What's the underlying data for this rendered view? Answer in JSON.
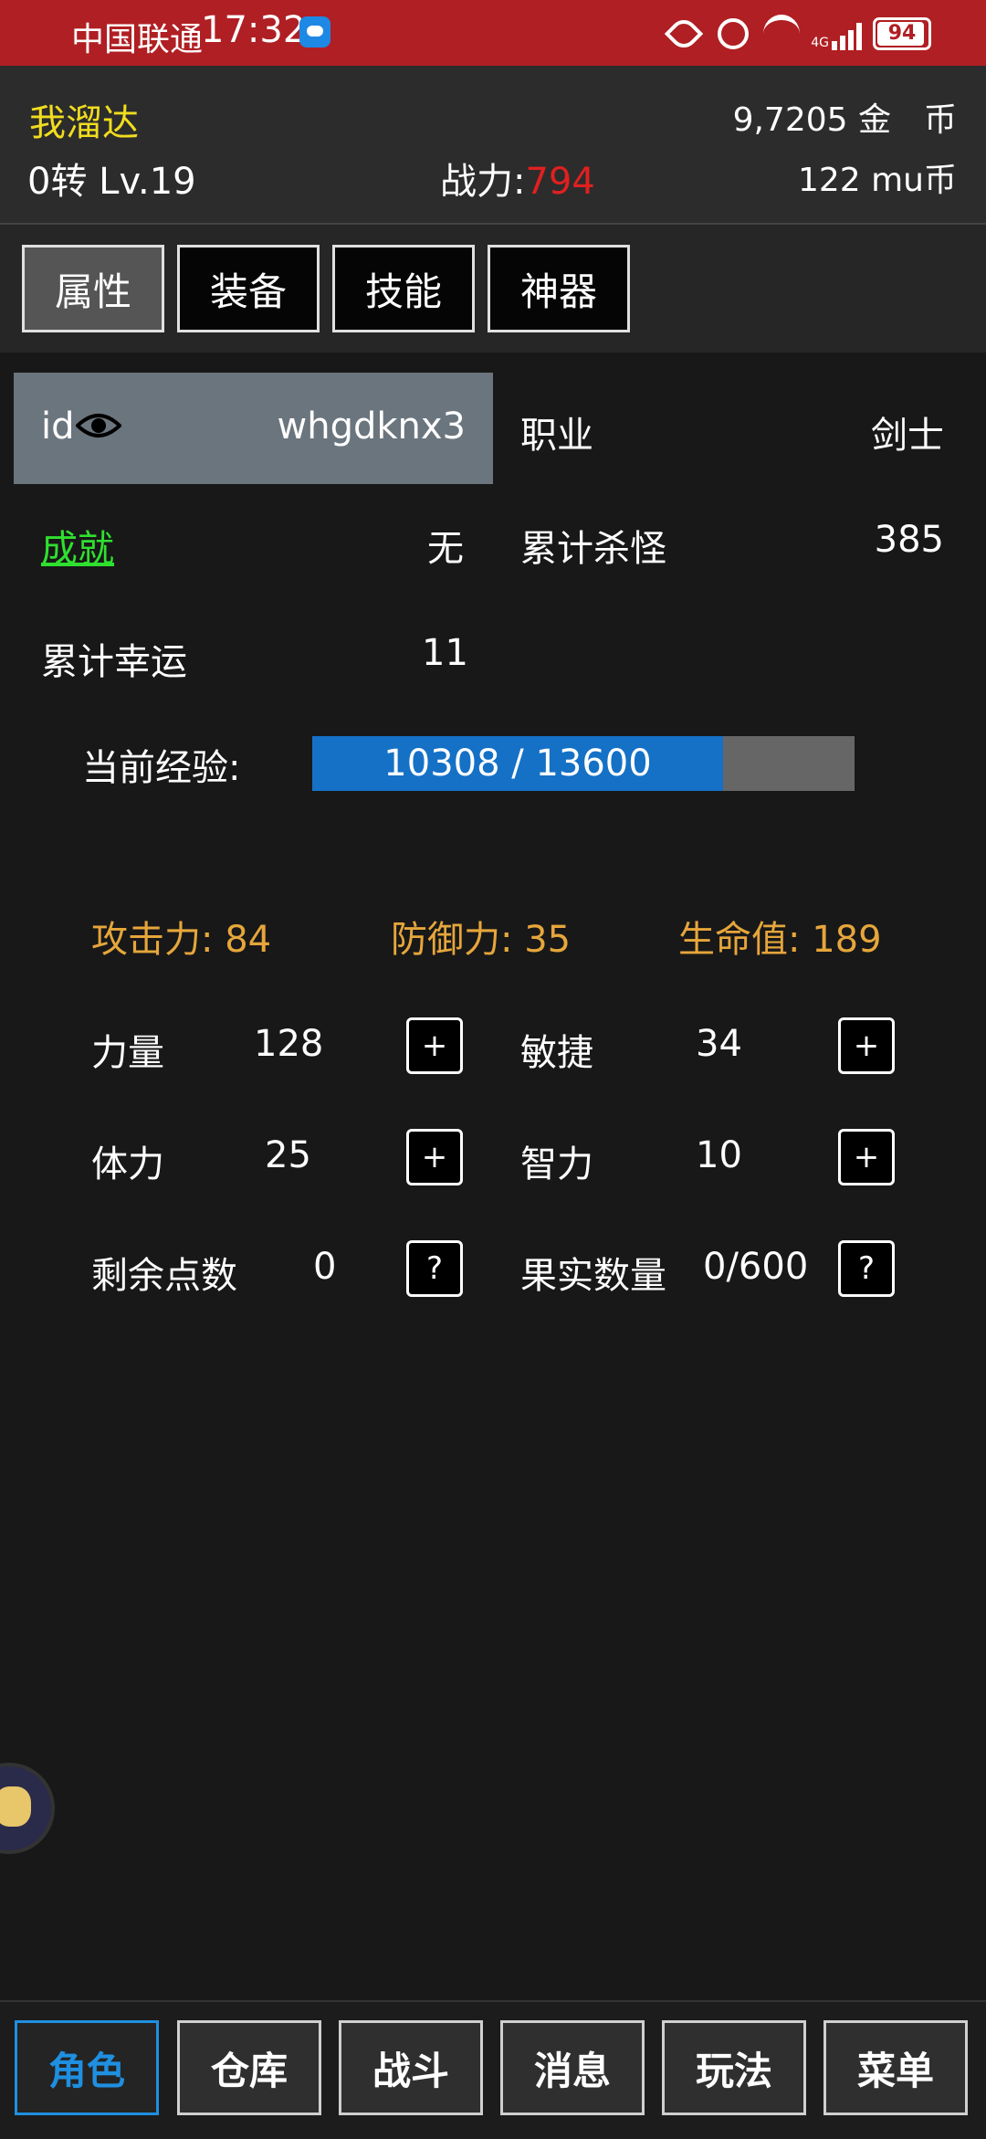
{
  "status_bar": {
    "carrier": "中国联通",
    "time": "17:32",
    "network": "4G",
    "battery": "94"
  },
  "header": {
    "player_name": "我溜达",
    "gold": "9,7205 金　币",
    "level": "0转 Lv.19",
    "power_label": "战力:",
    "power_value": "794",
    "mu_coin": "122 mu币"
  },
  "tabs": [
    {
      "label": "属性",
      "active": true
    },
    {
      "label": "装备",
      "active": false
    },
    {
      "label": "技能",
      "active": false
    },
    {
      "label": "神器",
      "active": false
    }
  ],
  "info": {
    "id_label": "id",
    "id_value": "whgdknx3",
    "job_label": "职业",
    "job_value": "剑士",
    "achievement_label": "成就",
    "achievement_value": "无",
    "kills_label": "累计杀怪",
    "kills_value": "385",
    "luck_label": "累计幸运",
    "luck_value": "11"
  },
  "experience": {
    "label": "当前经验:",
    "current": 10308,
    "max": 13600,
    "text": "10308 / 13600"
  },
  "combat_stats": {
    "attack": "攻击力: 84",
    "defense": "防御力: 35",
    "hp": "生命值: 189"
  },
  "attributes": {
    "strength_label": "力量",
    "strength_value": "128",
    "agility_label": "敏捷",
    "agility_value": "34",
    "stamina_label": "体力",
    "stamina_value": "25",
    "intellect_label": "智力",
    "intellect_value": "10",
    "remaining_label": "剩余点数",
    "remaining_value": "0",
    "fruit_label": "果实数量",
    "fruit_value": "0/600",
    "plus": "+",
    "help": "?"
  },
  "bottom_nav": [
    {
      "label": "角色",
      "active": true
    },
    {
      "label": "仓库",
      "active": false
    },
    {
      "label": "战斗",
      "active": false
    },
    {
      "label": "消息",
      "active": false
    },
    {
      "label": "玩法",
      "active": false
    },
    {
      "label": "菜单",
      "active": false
    }
  ],
  "colors": {
    "status_bar": "#b01f23",
    "name_yellow": "#f0dd1f",
    "power_red": "#e02020",
    "stat_orange": "#e6a63b",
    "link_green": "#2fe02f",
    "exp_blue": "#1571c6",
    "nav_active": "#1f8fe0"
  }
}
